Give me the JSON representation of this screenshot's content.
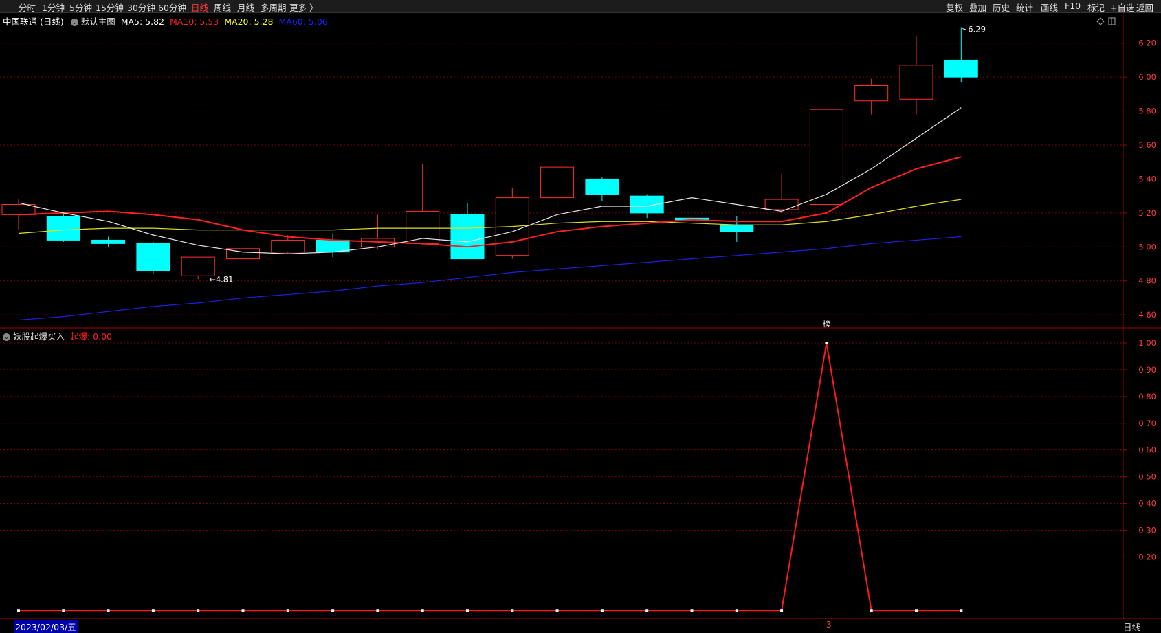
{
  "toolbar": {
    "left_items": [
      {
        "label": "分时",
        "active": false
      },
      {
        "label": "1分钟",
        "active": false
      },
      {
        "label": "5分钟",
        "active": false
      },
      {
        "label": "15分钟",
        "active": false
      },
      {
        "label": "30分钟",
        "active": false
      },
      {
        "label": "60分钟",
        "active": false
      },
      {
        "label": "日线",
        "active": true
      },
      {
        "label": "周线",
        "active": false
      },
      {
        "label": "月线",
        "active": false
      },
      {
        "label": "多周期",
        "active": false
      },
      {
        "label": "更多 〉",
        "active": false
      }
    ],
    "right_items": [
      "复权",
      "叠加",
      "历史",
      "统计",
      "画线",
      "F10",
      "标记",
      "+自选",
      "返回"
    ]
  },
  "main_panel": {
    "stock_name": "中国联通 (日线)",
    "template_label": "默认主图",
    "ma_legend": [
      {
        "label": "MA5: 5.82",
        "color": "#ffffff"
      },
      {
        "label": "MA10: 5.53",
        "color": "#ff2020"
      },
      {
        "label": "MA20: 5.28",
        "color": "#ffff00"
      },
      {
        "label": "MA60: 5.06",
        "color": "#2020ff"
      }
    ],
    "high_label": "6.29",
    "low_label": "←4.81"
  },
  "indicator_panel": {
    "name": "妖股起爆买入",
    "value_label": "起爆: 0.00",
    "marker_text": "榜"
  },
  "footer": {
    "date_cursor": "2023/02/03/五",
    "period": "日线",
    "marker": "3"
  },
  "colors": {
    "up": "#ff3030",
    "down": "#00ffff",
    "ma5": "#e8e8e8",
    "ma10": "#ff2020",
    "ma20": "#e0e020",
    "ma60": "#2020e0",
    "grid": "#7a0000"
  },
  "chart_data": [
    {
      "type": "candlestick",
      "y_ticks": [
        "6.20",
        "6.00",
        "5.80",
        "5.60",
        "5.40",
        "5.20",
        "5.00",
        "4.80",
        "4.60"
      ],
      "ylim": [
        4.54,
        6.3
      ],
      "candles": [
        {
          "o": 5.19,
          "h": 5.28,
          "l": 5.1,
          "c": 5.25
        },
        {
          "o": 5.18,
          "h": 5.2,
          "l": 5.03,
          "c": 5.04
        },
        {
          "o": 5.04,
          "h": 5.06,
          "l": 5.0,
          "c": 5.02
        },
        {
          "o": 5.02,
          "h": 5.03,
          "l": 4.84,
          "c": 4.86
        },
        {
          "o": 4.83,
          "h": 4.94,
          "l": 4.81,
          "c": 4.94
        },
        {
          "o": 4.93,
          "h": 5.03,
          "l": 4.91,
          "c": 4.99
        },
        {
          "o": 4.97,
          "h": 5.07,
          "l": 4.96,
          "c": 5.04
        },
        {
          "o": 5.04,
          "h": 5.08,
          "l": 4.94,
          "c": 4.97
        },
        {
          "o": 5.0,
          "h": 5.19,
          "l": 4.99,
          "c": 5.05
        },
        {
          "o": 5.02,
          "h": 5.49,
          "l": 5.01,
          "c": 5.21
        },
        {
          "o": 5.19,
          "h": 5.26,
          "l": 4.93,
          "c": 4.93
        },
        {
          "o": 4.95,
          "h": 5.35,
          "l": 4.93,
          "c": 5.29
        },
        {
          "o": 5.29,
          "h": 5.48,
          "l": 5.24,
          "c": 5.47
        },
        {
          "o": 5.4,
          "h": 5.41,
          "l": 5.27,
          "c": 5.31
        },
        {
          "o": 5.3,
          "h": 5.31,
          "l": 5.17,
          "c": 5.2
        },
        {
          "o": 5.17,
          "h": 5.22,
          "l": 5.11,
          "c": 5.16
        },
        {
          "o": 5.13,
          "h": 5.18,
          "l": 5.03,
          "c": 5.09
        },
        {
          "o": 5.22,
          "h": 5.43,
          "l": 5.2,
          "c": 5.28
        },
        {
          "o": 5.25,
          "h": 5.81,
          "l": 5.25,
          "c": 5.81
        },
        {
          "o": 5.86,
          "h": 5.99,
          "l": 5.78,
          "c": 5.95
        },
        {
          "o": 5.87,
          "h": 6.24,
          "l": 5.78,
          "c": 6.07
        },
        {
          "o": 6.1,
          "h": 6.29,
          "l": 5.97,
          "c": 6.0
        }
      ],
      "ma5": [
        5.26,
        5.2,
        5.15,
        5.07,
        5.01,
        4.97,
        4.96,
        4.97,
        5.0,
        5.05,
        5.03,
        5.09,
        5.19,
        5.24,
        5.24,
        5.29,
        5.25,
        5.21,
        5.31,
        5.46,
        5.64,
        5.82
      ],
      "ma10": [
        5.19,
        5.2,
        5.21,
        5.19,
        5.16,
        5.1,
        5.06,
        5.04,
        5.03,
        5.02,
        5.0,
        5.03,
        5.09,
        5.12,
        5.14,
        5.16,
        5.15,
        5.15,
        5.2,
        5.35,
        5.46,
        5.53
      ],
      "ma20": [
        5.08,
        5.1,
        5.11,
        5.11,
        5.1,
        5.1,
        5.1,
        5.1,
        5.11,
        5.11,
        5.11,
        5.12,
        5.14,
        5.15,
        5.15,
        5.14,
        5.13,
        5.13,
        5.15,
        5.19,
        5.24,
        5.28
      ],
      "ma60": [
        4.57,
        4.59,
        4.62,
        4.65,
        4.67,
        4.7,
        4.72,
        4.74,
        4.77,
        4.79,
        4.82,
        4.85,
        4.87,
        4.89,
        4.91,
        4.93,
        4.95,
        4.97,
        4.99,
        5.02,
        5.04,
        5.06
      ]
    },
    {
      "type": "line",
      "series": [
        {
          "name": "起爆",
          "values": [
            0,
            0,
            0,
            0,
            0,
            0,
            0,
            0,
            0,
            0,
            0,
            0,
            0,
            0,
            0,
            0,
            0,
            0,
            1,
            0,
            0,
            0
          ]
        }
      ],
      "y_ticks": [
        "1.00",
        "0.90",
        "0.80",
        "0.70",
        "0.60",
        "0.50",
        "0.40",
        "0.30",
        "0.20"
      ],
      "ylim": [
        -0.02,
        1.0
      ]
    }
  ]
}
